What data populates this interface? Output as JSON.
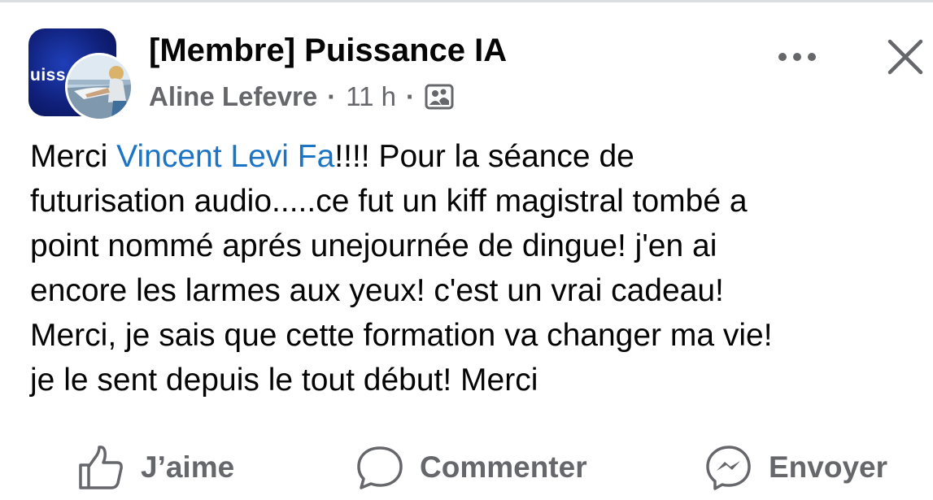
{
  "post": {
    "group_name": "[Membre] Puissance IA",
    "group_avatar_text": "uiss",
    "author": "Aline Lefevre",
    "separator": "·",
    "time": "11 h",
    "audience_icon": "members-only-icon",
    "body": {
      "line1_before": "Merci ",
      "mention": "Vincent Levi Fa",
      "line1_after": "!!!! Pour la séance de",
      "line2": "futurisation audio.....ce fut un kiff magistral tombé a",
      "line3": "point nommé aprés unejournée de dingue! j'en ai",
      "line4": "encore les larmes aux yeux! c'est un vrai cadeau!",
      "line5": "Merci, je sais que cette formation va changer ma vie!",
      "line6": "je le sent depuis le tout début! Merci"
    }
  },
  "actions": {
    "like": {
      "label": "J’aime",
      "icon": "thumbs-up-icon"
    },
    "comment": {
      "label": "Commenter",
      "icon": "comment-icon"
    },
    "send": {
      "label": "Envoyer",
      "icon": "messenger-icon"
    }
  },
  "colors": {
    "mention": "#1b74c4",
    "secondary_text": "#65676b",
    "group_tile": "#10207a"
  }
}
